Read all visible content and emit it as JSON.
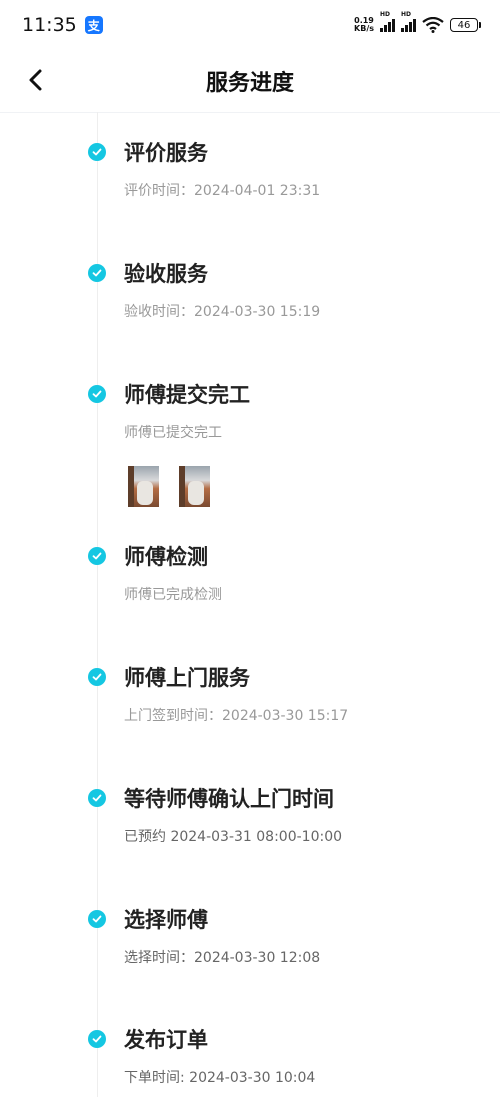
{
  "status_bar": {
    "time": "11:35",
    "alipay_badge": "支",
    "speed_value": "0.19",
    "speed_unit": "KB/s",
    "signal_label": "HD",
    "battery": "46"
  },
  "header": {
    "title": "服务进度"
  },
  "steps": [
    {
      "title": "评价服务",
      "desc": "评价时间：2024-04-01 23:31"
    },
    {
      "title": "验收服务",
      "desc": "验收时间：2024-03-30 15:19"
    },
    {
      "title": "师傅提交完工",
      "desc": "师傅已提交完工"
    },
    {
      "title": "师傅检测",
      "desc": "师傅已完成检测"
    },
    {
      "title": "师傅上门服务",
      "desc": "上门签到时间：2024-03-30 15:17"
    },
    {
      "title": "等待师傅确认上门时间",
      "desc": "已预约 2024-03-31 08:00-10:00"
    },
    {
      "title": "选择师傅",
      "desc": "选择时间：2024-03-30 12:08"
    },
    {
      "title": "发布订单",
      "desc": "下单时间: 2024-03-30 10:04"
    }
  ],
  "colors": {
    "accent": "#15c7e2"
  }
}
